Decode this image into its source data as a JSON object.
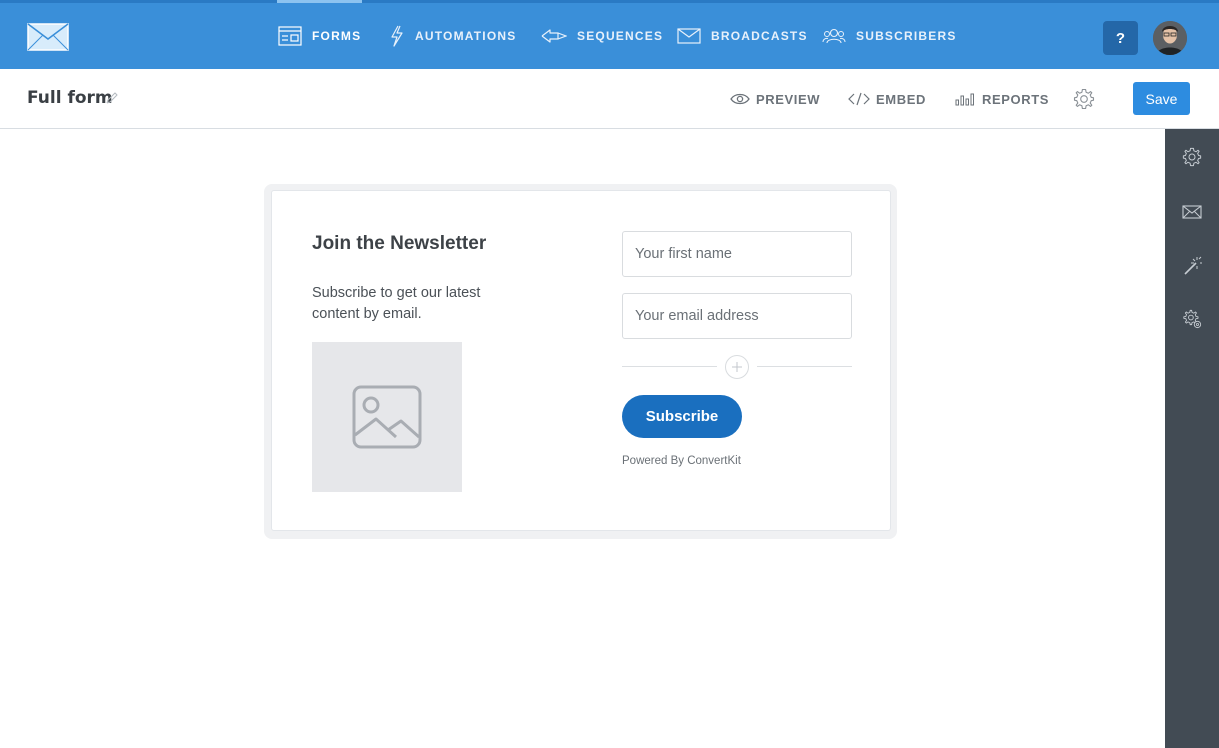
{
  "nav": {
    "items": [
      {
        "label": "FORMS",
        "icon": "form-icon",
        "active": true
      },
      {
        "label": "AUTOMATIONS",
        "icon": "lightning-icon",
        "active": false
      },
      {
        "label": "SEQUENCES",
        "icon": "sequence-icon",
        "active": false
      },
      {
        "label": "BROADCASTS",
        "icon": "envelope-icon",
        "active": false
      },
      {
        "label": "SUBSCRIBERS",
        "icon": "users-icon",
        "active": false
      }
    ],
    "help_label": "?"
  },
  "subheader": {
    "title": "Full form",
    "actions": [
      {
        "label": "PREVIEW",
        "icon": "eye-icon"
      },
      {
        "label": "EMBED",
        "icon": "code-icon"
      },
      {
        "label": "REPORTS",
        "icon": "bar-chart-icon"
      }
    ],
    "save_label": "Save"
  },
  "form": {
    "heading": "Join the Newsletter",
    "description": "Subscribe to get our latest content by email.",
    "first_name_placeholder": "Your first name",
    "email_placeholder": "Your email address",
    "subscribe_label": "Subscribe",
    "powered_by": "Powered By ConvertKit"
  },
  "rightbar": {
    "icons": [
      "gear-icon",
      "envelope-icon",
      "magic-wand-icon",
      "advanced-settings-icon"
    ]
  },
  "colors": {
    "nav_bg": "#3a8fd9",
    "help_bg": "#2467a8",
    "save_bg": "#2d8ce0",
    "subscribe_bg": "#1a6fbf",
    "rightbar_bg": "#424b54"
  }
}
